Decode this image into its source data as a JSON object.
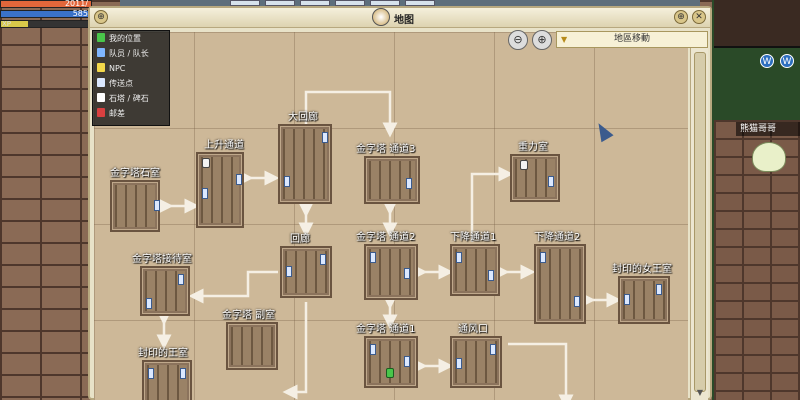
{
  "hud": {
    "hp_text": "2011/",
    "mp_text": "585",
    "xp_label": "XP",
    "colors": {
      "hp": "#e2673b",
      "mp": "#3a72c9",
      "xp": "#d8c94a"
    }
  },
  "window": {
    "title": "地图",
    "close_icon": "close-icon",
    "zoom_icon": "magnifier-icon"
  },
  "legend": [
    {
      "label": "我的位置",
      "icon": "my-position-icon",
      "color": "#49c64a"
    },
    {
      "label": "队员 / 队长",
      "icon": "party-icon",
      "color": "#7fb6ff"
    },
    {
      "label": "NPC",
      "icon": "npc-icon",
      "color": "#f3d84a"
    },
    {
      "label": "传送点",
      "icon": "portal-icon",
      "color": "#dbe8ff"
    },
    {
      "label": "石塔 / 碑石",
      "icon": "tower-icon",
      "color": "#ffffff"
    },
    {
      "label": "邮差",
      "icon": "postman-icon",
      "color": "#d94040"
    }
  ],
  "controls": {
    "zoom_out_icon": "zoom-out-icon",
    "zoom_in_icon": "zoom-in-icon",
    "dropdown_value": "地區移動"
  },
  "rooms": [
    {
      "id": "jinzita-shishi",
      "name": "金字塔石室"
    },
    {
      "id": "shangsheng-tongdao",
      "name": "上升通道"
    },
    {
      "id": "da-huilang",
      "name": "大回廊"
    },
    {
      "id": "jinzita-tongdao3",
      "name": "金字塔 通道3"
    },
    {
      "id": "zhongli-shi",
      "name": "重力室"
    },
    {
      "id": "jinzita-jiedaishi",
      "name": "金字塔接待室"
    },
    {
      "id": "huilang",
      "name": "回廊"
    },
    {
      "id": "jinzita-tongdao2",
      "name": "金字塔 通道2"
    },
    {
      "id": "xiajiang-tongdao1",
      "name": "下降通道1"
    },
    {
      "id": "xiajiang-tongdao2",
      "name": "下降通道2"
    },
    {
      "id": "fengyin-nvwangshi",
      "name": "封印的女王室"
    },
    {
      "id": "jinzita-fushi",
      "name": "金字塔 副室"
    },
    {
      "id": "jinzita-tongdao1",
      "name": "金字塔 通道1"
    },
    {
      "id": "tongfengkou",
      "name": "通风口"
    },
    {
      "id": "fengyin-wangshi",
      "name": "封印的王室"
    }
  ],
  "side": {
    "npc_name": "熊猫哥哥",
    "minimap_icons": [
      "world-icon",
      "world-icon-2"
    ]
  }
}
